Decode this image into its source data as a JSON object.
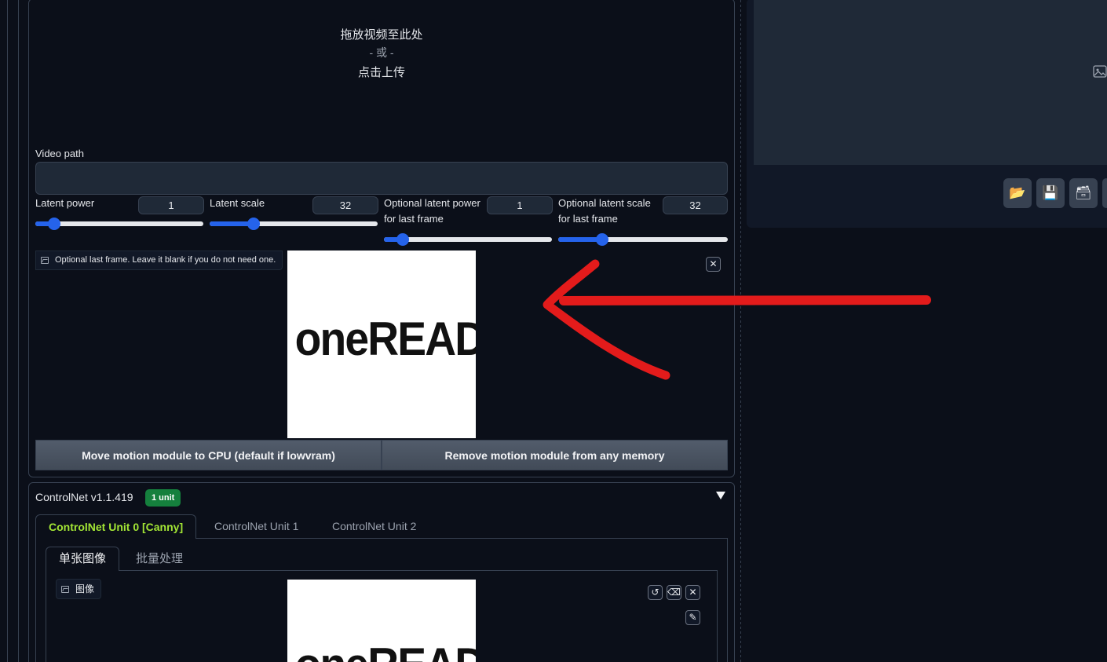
{
  "video_upload": {
    "drop_text": "拖放视频至此处",
    "or_text": "- 或 -",
    "click_text": "点击上传"
  },
  "video_path": {
    "label": "Video path",
    "value": ""
  },
  "sliders": [
    {
      "label": "Latent power",
      "value": "1",
      "fraction": 0.11
    },
    {
      "label": "Latent scale",
      "value": "32",
      "fraction": 0.26
    },
    {
      "label_line1": "Optional latent power",
      "label_line2": "for last frame",
      "value": "1",
      "fraction": 0.11
    },
    {
      "label_line1": "Optional latent scale",
      "label_line2": "for last frame",
      "value": "32",
      "fraction": 0.26
    }
  ],
  "last_frame": {
    "label": "Optional last frame. Leave it blank if you do not need one.",
    "image_text": "oneREAD"
  },
  "buttons": {
    "move_cpu": "Move motion module to CPU (default if lowvram)",
    "remove_memory": "Remove motion module from any memory"
  },
  "controlnet": {
    "title": "ControlNet v1.1.419",
    "badge": "1 unit",
    "tabs": [
      "ControlNet Unit 0 [Canny]",
      "ControlNet Unit 1",
      "ControlNet Unit 2"
    ],
    "subtabs": [
      "单张图像",
      "批量处理"
    ],
    "image_label": "图像",
    "image_text": "oneREAD"
  },
  "icons": {
    "close": "✕",
    "undo": "↺",
    "eraser": "⌫",
    "brush": "✎",
    "folder": "📂",
    "save": "💾",
    "zip": "🗃"
  },
  "colors": {
    "accent": "#2563eb",
    "active_tab": "#a3e635",
    "badge": "#15803d",
    "annotation_arrow": "#e31b1b"
  }
}
